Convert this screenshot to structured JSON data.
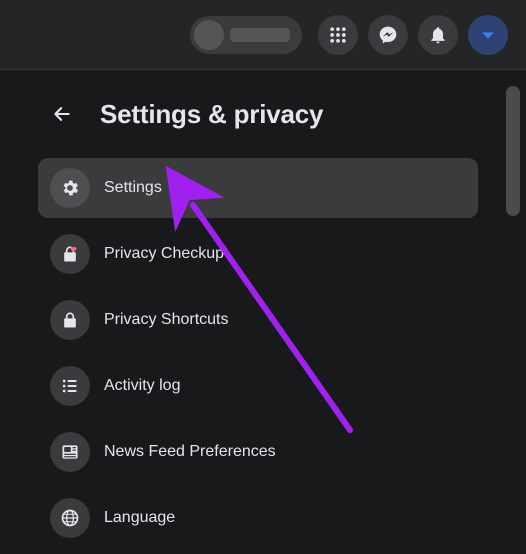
{
  "header": {
    "grid_icon": "menu-grid-icon",
    "messenger_icon": "messenger-icon",
    "bell_icon": "notifications-icon",
    "chev_icon": "account-chevron-icon"
  },
  "panel": {
    "title": "Settings & privacy",
    "items": [
      {
        "label": "Settings",
        "icon": "gear-icon",
        "selected": true
      },
      {
        "label": "Privacy Checkup",
        "icon": "lock-heart-icon",
        "selected": false
      },
      {
        "label": "Privacy Shortcuts",
        "icon": "lock-icon",
        "selected": false
      },
      {
        "label": "Activity log",
        "icon": "list-icon",
        "selected": false
      },
      {
        "label": "News Feed Preferences",
        "icon": "newspaper-icon",
        "selected": false
      },
      {
        "label": "Language",
        "icon": "globe-icon",
        "selected": false
      }
    ]
  },
  "annotation": {
    "color": "#a020f0"
  }
}
